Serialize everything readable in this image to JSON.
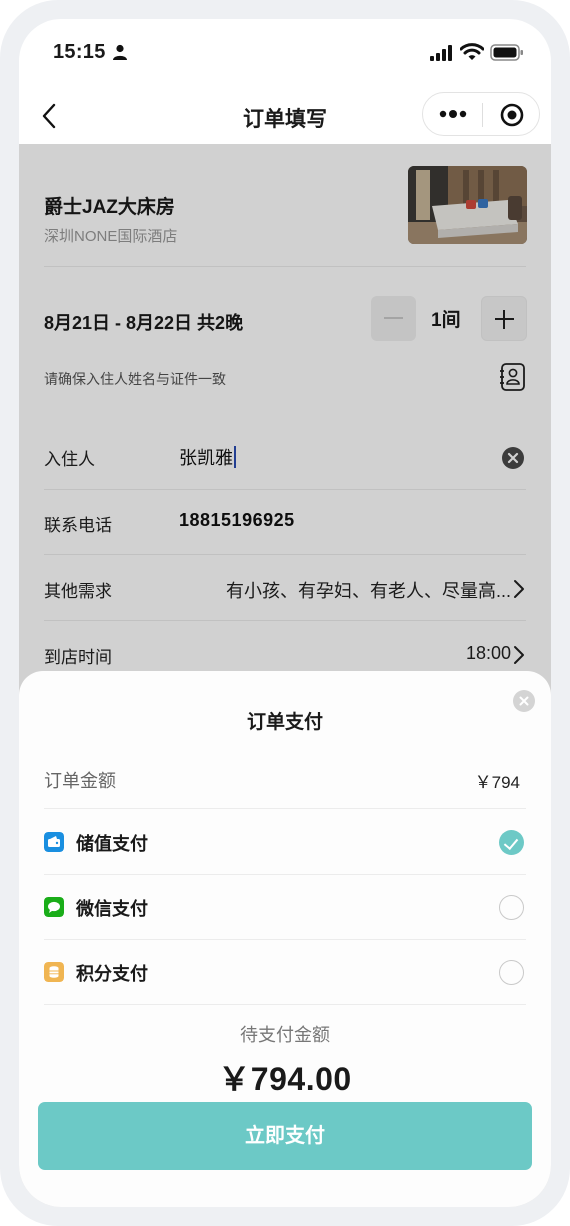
{
  "status_bar": {
    "time": "15:15"
  },
  "nav": {
    "title": "订单填写"
  },
  "room": {
    "name": "爵士JAZ大床房",
    "hotel": "深圳NONE国际酒店"
  },
  "stay": {
    "dates": "8月21日 - 8月22日 共2晚",
    "rooms": "1间"
  },
  "notice": "请确保入住人姓名与证件一致",
  "form": {
    "guest_label": "入住人",
    "guest_value": "张凯雅",
    "phone_label": "联系电话",
    "phone_value": "18815196925",
    "other_label": "其他需求",
    "other_value": "有小孩、有孕妇、有老人、尽量高...",
    "arrival_label": "到店时间",
    "arrival_value": "18:00"
  },
  "payment_sheet": {
    "title": "订单支付",
    "amount_label": "订单金额",
    "amount_value": "￥794",
    "methods": [
      {
        "label": "储值支付",
        "icon": "wallet-icon",
        "color": "#1a8fe0",
        "selected": true
      },
      {
        "label": "微信支付",
        "icon": "wechat-icon",
        "color": "#1aad19",
        "selected": false
      },
      {
        "label": "积分支付",
        "icon": "coins-icon",
        "color": "#f0b552",
        "selected": false
      }
    ],
    "due_label": "待支付金额",
    "due_value": "￥794.00",
    "pay_button": "立即支付"
  },
  "colors": {
    "accent": "#6cc9c6",
    "overlay": "rgba(0,0,0,0.18)"
  }
}
